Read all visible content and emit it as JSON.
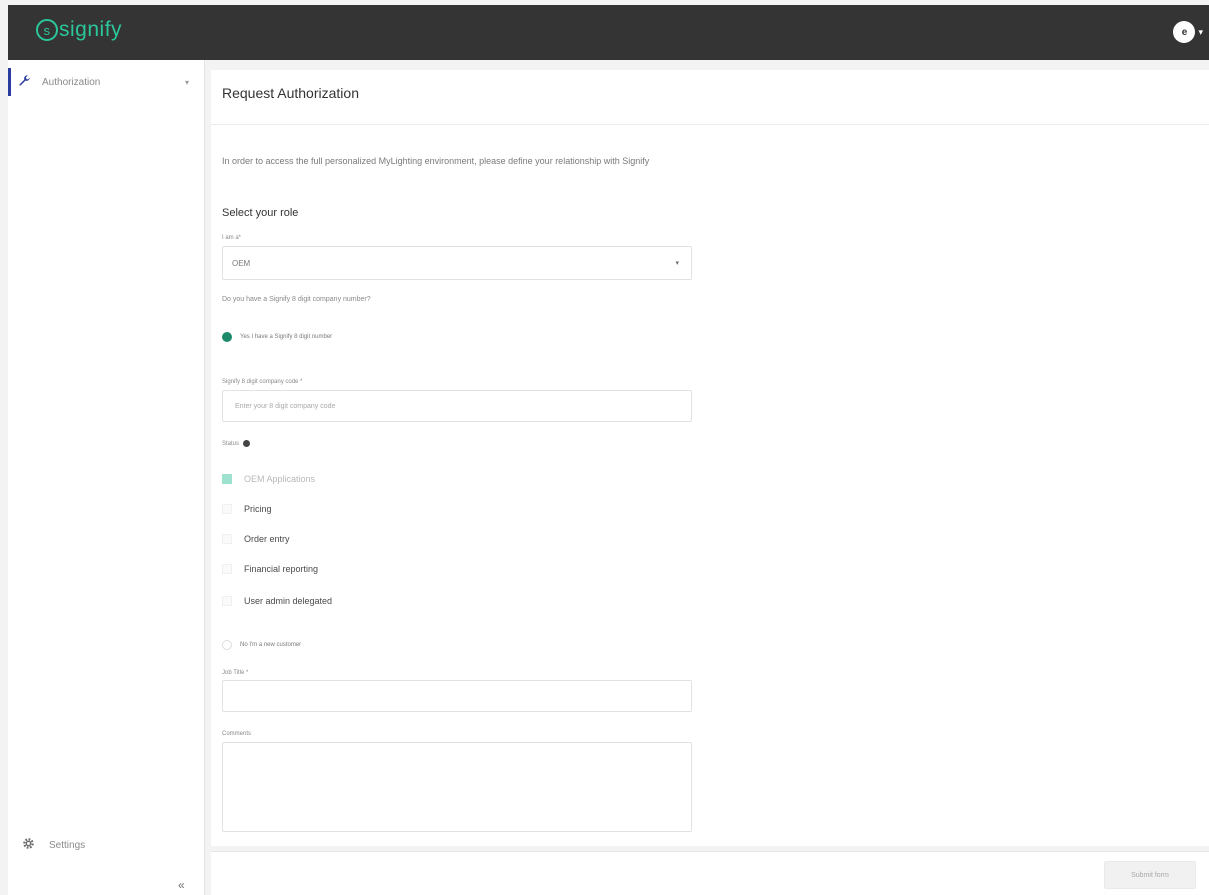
{
  "header": {
    "logo_text": "signify",
    "logo_mark": "s",
    "avatar_initial": "e",
    "user_caret": "▾",
    "icons": {
      "logo": "signify-logo",
      "avatar": "user-avatar-icon",
      "caret": "chevron-down-icon"
    }
  },
  "sidebar": {
    "items": [
      {
        "label": "Authorization",
        "icon": "wrench-icon",
        "chevron": "▾",
        "active": true
      }
    ],
    "settings_label": "Settings",
    "settings_icon": "gear-icon",
    "collapse_glyph": "«",
    "accent_color": "#2a3d9e"
  },
  "main": {
    "title": "Request Authorization",
    "intro": "In order to access the full personalized MyLighting environment, please define your relationship with Signify",
    "section_title": "Select your role",
    "role": {
      "label": "I am a*",
      "value": "OEM",
      "caret": "▾"
    },
    "company_question": "Do you have a Signify 8 digit company number?",
    "radio_have_number": "Yes I have a Signify 8 digit number",
    "company_number": {
      "label": "Signify 8 digit company code *",
      "placeholder": "Enter your 8 digit company code"
    },
    "status_label": "Status",
    "checkboxes": [
      {
        "label": "OEM Applications",
        "checked": true,
        "disabled": true
      },
      {
        "label": "Pricing",
        "checked": false,
        "disabled": false
      },
      {
        "label": "Order entry",
        "checked": false,
        "disabled": false
      },
      {
        "label": "Financial reporting",
        "checked": false,
        "disabled": false
      },
      {
        "label": "User admin delegated",
        "checked": false,
        "disabled": false
      }
    ],
    "radio_new_customer": "No I'm a new customer",
    "job_title_label": "Job Title *",
    "comments_label": "Comments"
  },
  "footer": {
    "submit_label": "Submit form"
  },
  "colors": {
    "brand_green": "#2bc69a",
    "radio_selected": "#1c8a6b",
    "topbar": "#343434"
  }
}
